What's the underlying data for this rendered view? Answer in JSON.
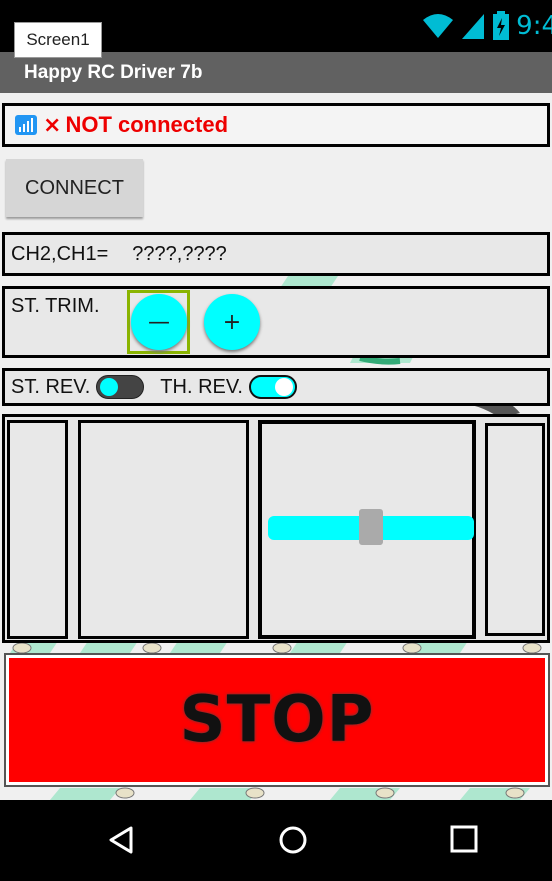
{
  "app": {
    "tab_label": "Screen1",
    "title": "Happy RC Driver 7b"
  },
  "status_bar": {
    "time": "9:4",
    "icons": [
      "wifi-icon",
      "signal-icon",
      "battery-icon"
    ]
  },
  "connection": {
    "icon": "bluetooth-signal-icon",
    "mark": "×",
    "status_text": "NOT connected",
    "status_color": "#e00000"
  },
  "connect_button": {
    "label": "CONNECT"
  },
  "channels": {
    "label": "CH2,CH1=",
    "value": "????,????"
  },
  "steering_trim": {
    "label": "ST. TRIM.",
    "minus_label": "—",
    "plus_label": "+"
  },
  "reverse": {
    "st_label": "ST. REV.",
    "st_on": false,
    "th_label": "TH. REV.",
    "th_on": true
  },
  "throttle_slider": {
    "value": 0.5
  },
  "stop_button": {
    "label": "STOP"
  },
  "colors": {
    "accent": "#00ffff",
    "title_bar": "#616161",
    "stop": "#ff0000",
    "focus": "#8ab400"
  },
  "navbar": {
    "icons": [
      "back-icon",
      "home-icon",
      "recents-icon"
    ]
  }
}
